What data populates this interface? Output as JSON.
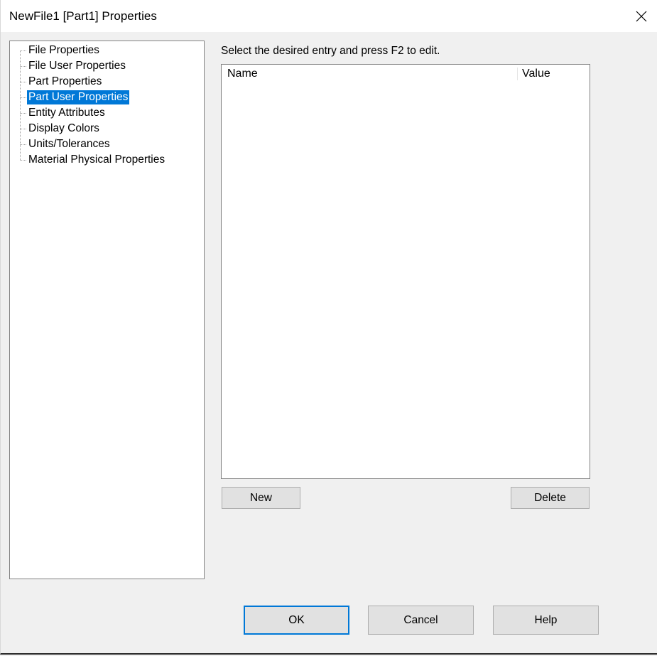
{
  "window": {
    "title": "NewFile1 [Part1] Properties",
    "close_icon": "close-x-icon"
  },
  "tree": {
    "items": [
      {
        "label": "File Properties",
        "selected": false
      },
      {
        "label": "File User Properties",
        "selected": false
      },
      {
        "label": "Part Properties",
        "selected": false
      },
      {
        "label": "Part User Properties",
        "selected": true
      },
      {
        "label": "Entity Attributes",
        "selected": false
      },
      {
        "label": "Display Colors",
        "selected": false
      },
      {
        "label": "Units/Tolerances",
        "selected": false
      },
      {
        "label": "Material Physical Properties",
        "selected": false
      }
    ]
  },
  "panel": {
    "instruction": "Select the desired entry and press F2 to edit.",
    "list": {
      "columns": [
        "Name",
        "Value"
      ],
      "rows": []
    },
    "new_label": "New",
    "delete_label": "Delete"
  },
  "footer": {
    "ok_label": "OK",
    "cancel_label": "Cancel",
    "help_label": "Help"
  },
  "colors": {
    "selection": "#0078d7",
    "default_button_border": "#0078d7",
    "dialog_background": "#f0f0f0"
  }
}
